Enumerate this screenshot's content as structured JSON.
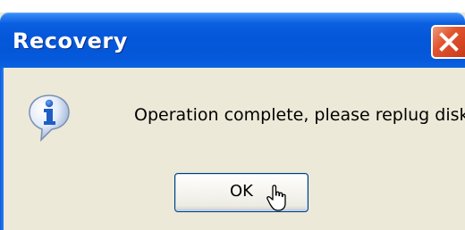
{
  "window": {
    "title": "Recovery"
  },
  "dialog": {
    "icon": "info-icon",
    "message": "Operation complete, please replug disk",
    "ok_label": "OK"
  },
  "colors": {
    "titlebar": "#0458D8",
    "dialog_background": "#ECE9D8",
    "close_button": "#E2552F",
    "info_icon": "#1E5EC4"
  }
}
